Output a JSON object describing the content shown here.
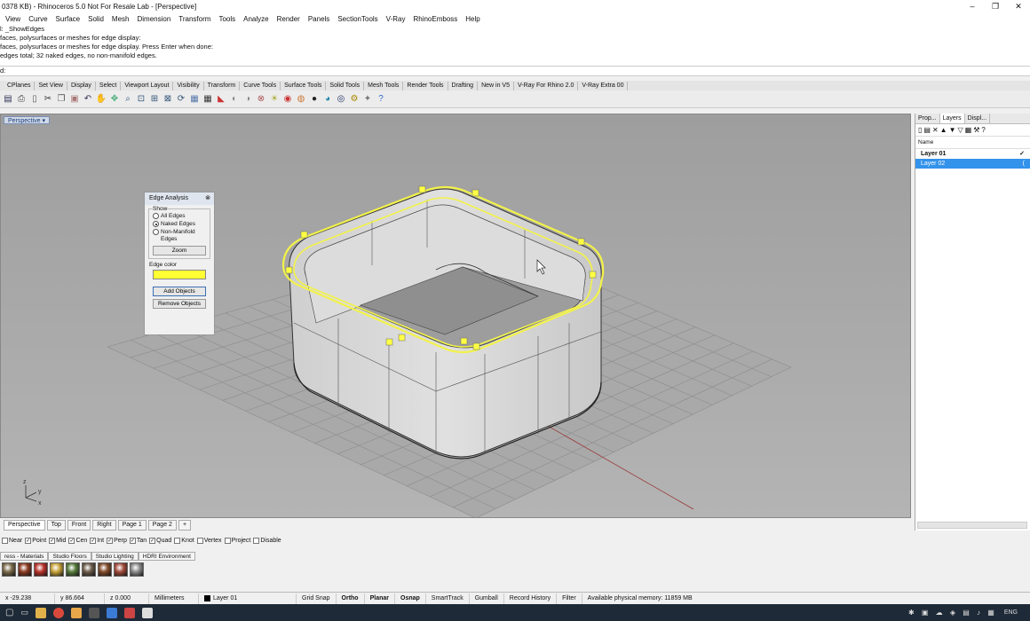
{
  "window": {
    "title": "0378 KB) - Rhinoceros 5.0 Not For Resale Lab - [Perspective]",
    "controls": [
      "–",
      "❐",
      "✕"
    ]
  },
  "menu": [
    "View",
    "Curve",
    "Surface",
    "Solid",
    "Mesh",
    "Dimension",
    "Transform",
    "Tools",
    "Analyze",
    "Render",
    "Panels",
    "SectionTools",
    "V-Ray",
    "RhinoEmboss",
    "Help"
  ],
  "command_history": [
    "l: _ShowEdges",
    "faces, polysurfaces or meshes for edge display:",
    "faces, polysurfaces or meshes for edge display. Press Enter when done:",
    "edges total; 32 naked edges, no non-manifold edges."
  ],
  "command_prompt": "d:",
  "toolbar_tabs": [
    "CPlanes",
    "Set View",
    "Display",
    "Select",
    "Viewport Layout",
    "Visibility",
    "Transform",
    "Curve Tools",
    "Surface Tools",
    "Solid Tools",
    "Mesh Tools",
    "Render Tools",
    "Drafting",
    "New in V5",
    "V-Ray For Rhino 2.0",
    "V-Ray Extra 00"
  ],
  "toolbar_icons": [
    "save-icon",
    "print-icon",
    "new-icon",
    "cut-icon",
    "copy-icon",
    "paste-icon",
    "undo-icon",
    "pan-icon",
    "move-icon",
    "zoom-icon",
    "zoom-window-icon",
    "zoom-extents-icon",
    "zoom-selected-icon",
    "rotate-view-icon",
    "four-views-icon",
    "grid-icon",
    "car-icon",
    "hide-icon",
    "show-icon",
    "lock-icon",
    "light-icon",
    "render-icon",
    "material-icon",
    "sphere-icon",
    "shaded-icon",
    "render-preview-icon",
    "options-icon",
    "wand-icon",
    "help-icon"
  ],
  "viewport": {
    "label": "Perspective",
    "axes": {
      "y": "y",
      "x": "x",
      "z": "z"
    }
  },
  "edge_analysis": {
    "title": "Edge Analysis",
    "show_label": "Show",
    "options": [
      "All Edges",
      "Naked Edges",
      "Non-Manifold Edges"
    ],
    "selected_index": 1,
    "zoom_label": "Zoom",
    "edge_color_label": "Edge color",
    "edge_color": "#ffff33",
    "add_objects_label": "Add Objects",
    "remove_objects_label": "Remove Objects"
  },
  "right_panel": {
    "tabs": [
      "Prop...",
      "Layers",
      "Displ..."
    ],
    "name_header": "Name",
    "layers": [
      {
        "name": "Layer 01",
        "check": "✓",
        "selected": false
      },
      {
        "name": "Layer 02",
        "check": "(",
        "selected": true
      }
    ]
  },
  "viewport_tabs": [
    "Perspective",
    "Top",
    "Front",
    "Right",
    "Page 1",
    "Page 2",
    "+"
  ],
  "osnaps": [
    {
      "label": "Near",
      "checked": false
    },
    {
      "label": "Point",
      "checked": true
    },
    {
      "label": "Mid",
      "checked": true
    },
    {
      "label": "Cen",
      "checked": true
    },
    {
      "label": "Int",
      "checked": true
    },
    {
      "label": "Perp",
      "checked": true
    },
    {
      "label": "Tan",
      "checked": true
    },
    {
      "label": "Quad",
      "checked": true
    },
    {
      "label": "Knot",
      "checked": false
    },
    {
      "label": "Vertex",
      "checked": false
    },
    {
      "label": "Project",
      "checked": false
    },
    {
      "label": "Disable",
      "checked": false
    }
  ],
  "material_tabs": [
    "ress - Materials",
    "Studio Floors",
    "Studio Lighting",
    "HDRI Environment"
  ],
  "material_swatches": [
    "#7a6a4a",
    "#8b3a22",
    "#b8322a",
    "#c7a23a",
    "#557a3a",
    "#6a5a4a",
    "#804a2a",
    "#a04a3a",
    "#8a8a8a"
  ],
  "status": {
    "x": "x -29.238",
    "y": "y 86.664",
    "z": "z 0.000",
    "units": "Millimeters",
    "layer": "Layer 01",
    "grid_snap": "Grid Snap",
    "ortho": "Ortho",
    "planar": "Planar",
    "osnap": "Osnap",
    "smarttrack": "SmartTrack",
    "gumball": "Gumball",
    "record_history": "Record History",
    "filter": "Filter",
    "memory": "Available physical memory: 11859 MB"
  },
  "taskbar": {
    "lang": "ENG"
  }
}
